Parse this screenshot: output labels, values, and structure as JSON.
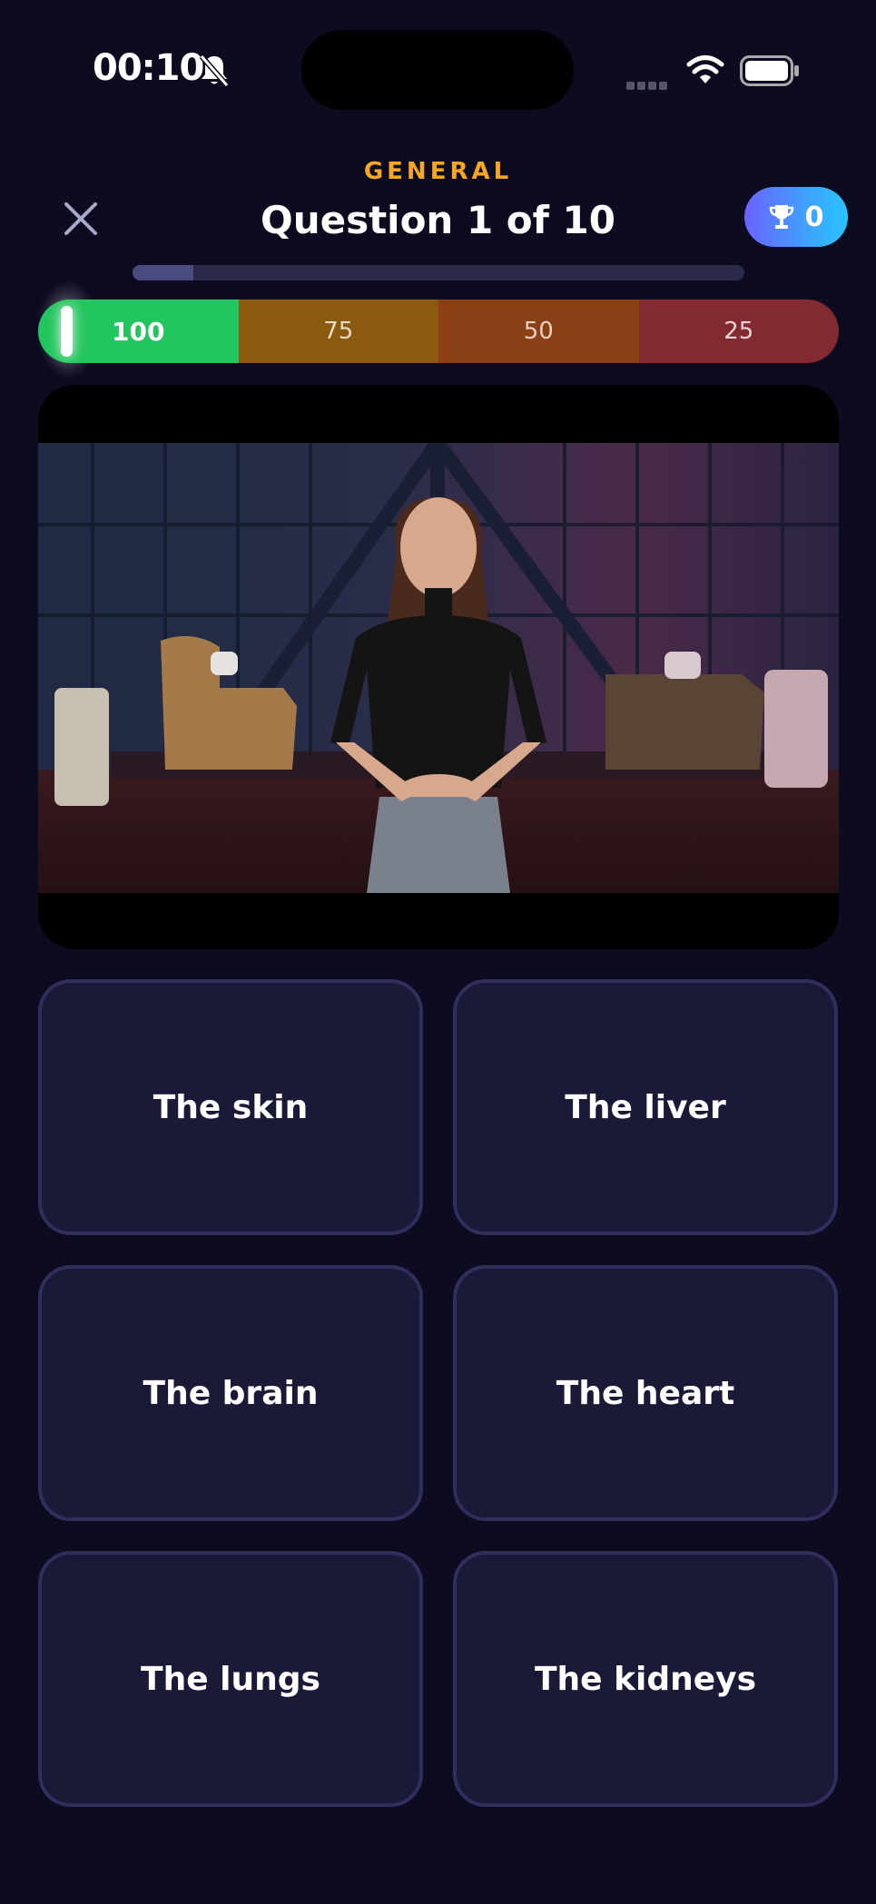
{
  "status_bar": {
    "time": "00:10",
    "icons": [
      "bell-slash-icon",
      "cellular-signal-icon",
      "wifi-icon",
      "battery-icon"
    ]
  },
  "header": {
    "category": "GENERAL",
    "title": "Question 1 of 10",
    "trophy_count": "0",
    "progress_fraction": 0.1
  },
  "score_bar": {
    "segments": [
      "100",
      "75",
      "50",
      "25"
    ],
    "current_value": "100",
    "colors": [
      "#22c55e",
      "#8a5a0e",
      "#8a3f14",
      "#822a32"
    ]
  },
  "answers": [
    {
      "label": "The skin"
    },
    {
      "label": "The liver"
    },
    {
      "label": "The brain"
    },
    {
      "label": "The heart"
    },
    {
      "label": "The lungs"
    },
    {
      "label": "The kidneys"
    }
  ],
  "theme": {
    "background": "#0c0b1f",
    "accent": "#f5a623",
    "card": "#1a1a38",
    "card_border": "#2f2e5c"
  }
}
